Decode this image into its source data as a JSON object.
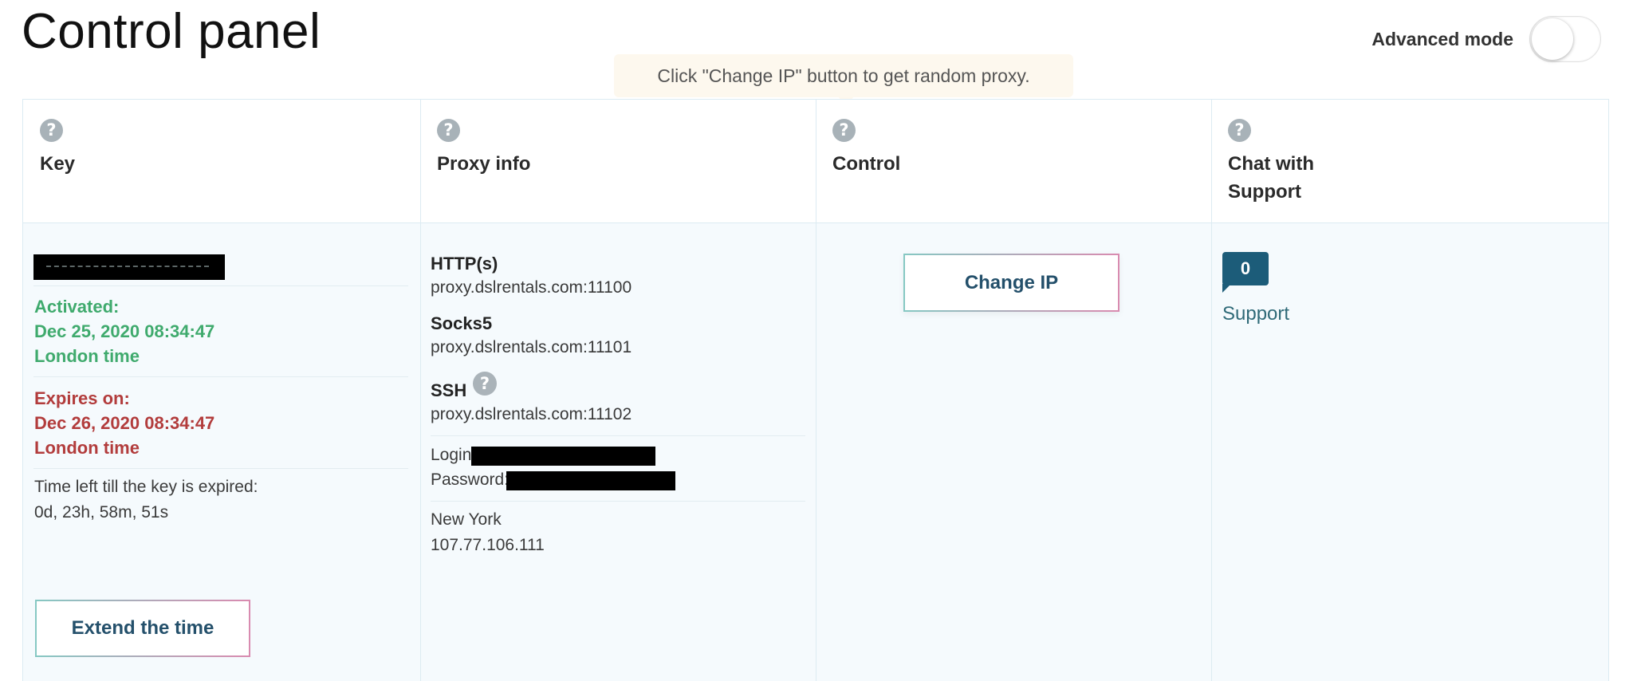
{
  "page": {
    "title": "Control panel"
  },
  "advanced_mode": {
    "label": "Advanced mode",
    "enabled": false
  },
  "tooltip": {
    "text": "Click \"Change IP\" button to get random proxy."
  },
  "columns": [
    {
      "title": "Key"
    },
    {
      "title": "Proxy info"
    },
    {
      "title": "Control"
    },
    {
      "title": "Chat with Support"
    }
  ],
  "key": {
    "activated_label": "Activated:",
    "activated_date": "Dec 25, 2020 08:34:47",
    "activated_tz": "London time",
    "expires_label": "Expires on:",
    "expires_date": "Dec 26, 2020 08:34:47",
    "expires_tz": "London time",
    "timeleft_label": "Time left till the key is expired:",
    "timeleft_value": "0d, 23h, 58m, 51s",
    "extend_button": "Extend the time"
  },
  "proxy": {
    "http_label": "HTTP(s)",
    "http_value": "proxy.dslrentals.com:11100",
    "socks_label": "Socks5",
    "socks_value": "proxy.dslrentals.com:11101",
    "ssh_label": "SSH",
    "ssh_value": "proxy.dslrentals.com:11102",
    "login_label": "Login:",
    "password_label": "Password:",
    "city": "New York",
    "ip": "107.77.106.111"
  },
  "control": {
    "change_ip_button": "Change IP"
  },
  "chat": {
    "unread_count": "0",
    "support_link": "Support"
  },
  "icons": {
    "help": "question-circle-icon"
  },
  "colors": {
    "activated": "#3faa6d",
    "expires": "#b23c3c",
    "badge": "#1c5c79",
    "button_text": "#24506b"
  }
}
